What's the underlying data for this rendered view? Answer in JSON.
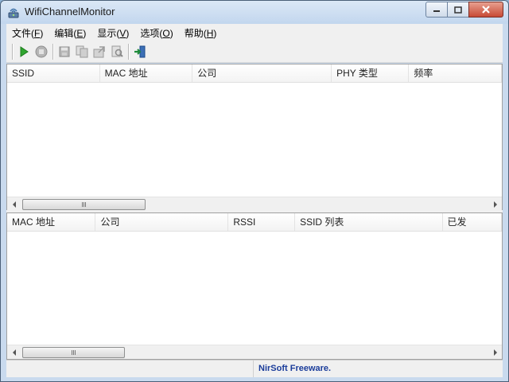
{
  "window": {
    "title": "WifiChannelMonitor"
  },
  "menu": [
    {
      "label": "文件(",
      "acc": "F",
      "end": ")"
    },
    {
      "label": "编辑(",
      "acc": "E",
      "end": ")"
    },
    {
      "label": "显示(",
      "acc": "V",
      "end": ")"
    },
    {
      "label": "选项(",
      "acc": "O",
      "end": ")"
    },
    {
      "label": "帮助(",
      "acc": "H",
      "end": ")"
    }
  ],
  "toolbar": {
    "buttons": [
      "start-icon",
      "stop-icon",
      "save-icon",
      "copy-icon",
      "properties-icon",
      "html-report-icon",
      "exit-icon"
    ]
  },
  "top_pane": {
    "columns": [
      "SSID",
      "MAC 地址",
      "公司",
      "PHY 类型",
      "频率"
    ],
    "rows": [],
    "scroll_position": 0.0
  },
  "bottom_pane": {
    "columns": [
      "MAC 地址",
      "公司",
      "RSSI",
      "SSID 列表",
      "已发"
    ],
    "rows": [],
    "scroll_position": 0.0
  },
  "status": {
    "link": "NirSoft Freeware."
  }
}
